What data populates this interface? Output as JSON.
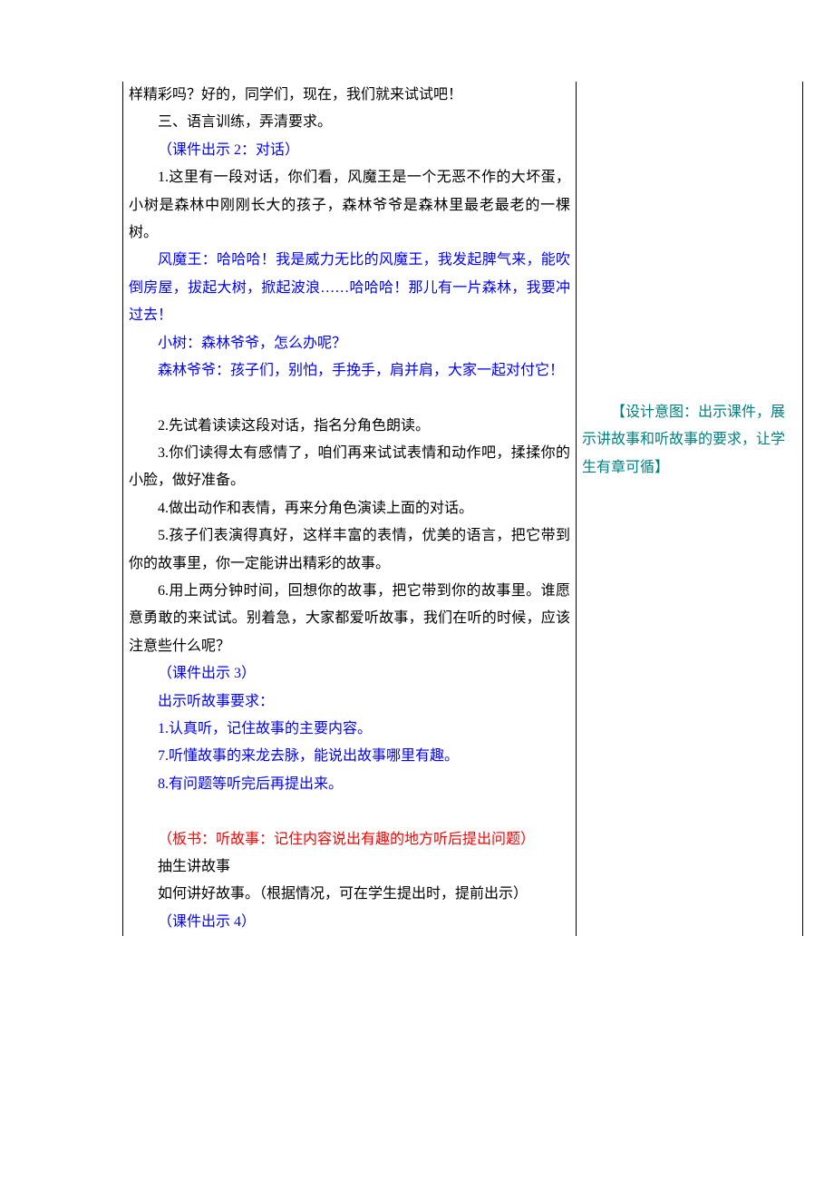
{
  "left": {
    "l1": "样精彩吗？好的，同学们，现在，我们就来试试吧！",
    "l2": "三、语言训练，弄清要求。",
    "l3": "（课件出示 2：对话）",
    "l4": "1.这里有一段对话，你们看，风魔王是一个无恶不作的大坏蛋，小树是森林中刚刚长大的孩子，森林爷爷是森林里最老最老的一棵树。",
    "l5": "风魔王：哈哈哈！我是威力无比的风魔王，我发起脾气来，能吹倒房屋，拔起大树，掀起波浪……哈哈哈！那儿有一片森林，我要冲过去！",
    "l6": "小树：森林爷爷，怎么办呢？",
    "l7": "森林爷爷：孩子们，别怕，手挽手，肩并肩，大家一起对付它！",
    "l8": "2.先试着读读这段对话，指名分角色朗读。",
    "l9": "3.你们读得太有感情了，咱们再来试试表情和动作吧，揉揉你的小脸，做好准备。",
    "l10": "4.做出动作和表情，再来分角色演读上面的对话。",
    "l11": "5.孩子们表演得真好，这样丰富的表情，优美的语言，把它带到你的故事里，你一定能讲出精彩的故事。",
    "l12": "6.用上两分钟时间，回想你的故事，把它带到你的故事里。谁愿意勇敢的来试试。别着急，大家都爱听故事，我们在听的时候，应该注意些什么呢？",
    "l13": "（课件出示 3）",
    "l14": "出示听故事要求：",
    "l15": "1.认真听，记住故事的主要内容。",
    "l16": "7.听懂故事的来龙去脉，能说出故事哪里有趣。",
    "l17": "8.有问题等听完后再提出来。",
    "l18": "（板书：听故事：记住内容说出有趣的地方听后提出问题）",
    "l19": "抽生讲故事",
    "l20": "如何讲好故事。（根据情况，可在学生提出时，提前出示）",
    "l21": "（课件出示 4）"
  },
  "right": {
    "note": "【设计意图：出示课件，展示讲故事和听故事的要求，让学生有章可循】"
  }
}
